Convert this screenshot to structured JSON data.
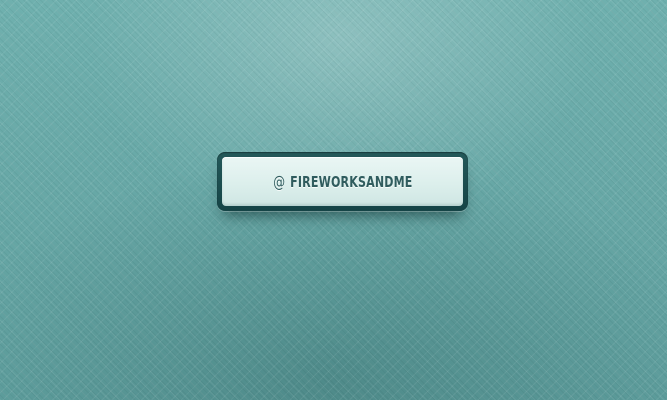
{
  "button": {
    "at_symbol": "@",
    "handle": "FIREWORKSANDME"
  },
  "colors": {
    "background": "#67a8a7",
    "frame": "#1c4f50",
    "face": "#dcefec",
    "text": "#2f5c5e"
  }
}
